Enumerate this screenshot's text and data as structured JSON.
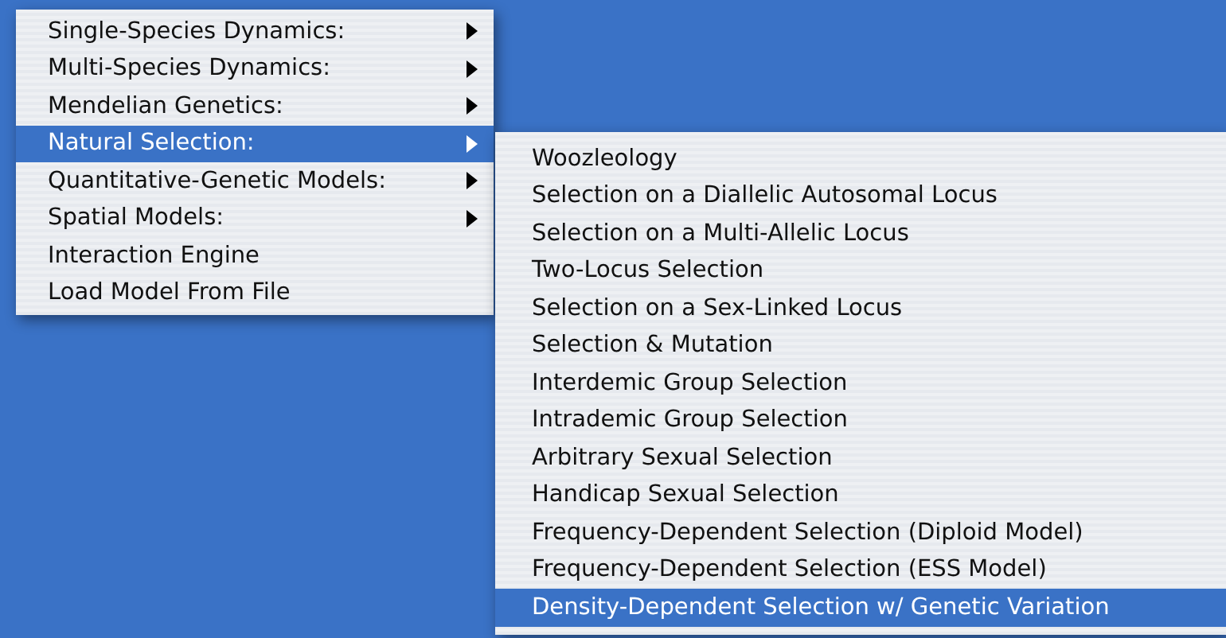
{
  "menu": {
    "items": [
      {
        "label": "Single-Species Dynamics:",
        "kind": "submenu",
        "selected": false
      },
      {
        "label": "Multi-Species Dynamics:",
        "kind": "submenu",
        "selected": false
      },
      {
        "label": "Mendelian Genetics:",
        "kind": "submenu",
        "selected": false
      },
      {
        "label": "Natural Selection:",
        "kind": "submenu",
        "selected": true
      },
      {
        "label": "Quantitative-Genetic Models:",
        "kind": "submenu",
        "selected": false
      },
      {
        "label": "Spatial Models:",
        "kind": "submenu",
        "selected": false
      },
      {
        "label": "Interaction Engine",
        "kind": "command",
        "selected": false
      },
      {
        "label": "Load Model From File",
        "kind": "command",
        "selected": false
      }
    ]
  },
  "submenu": {
    "items": [
      {
        "label": "Woozleology",
        "selected": false
      },
      {
        "label": "Selection on a Diallelic Autosomal Locus",
        "selected": false
      },
      {
        "label": "Selection on a Multi-Allelic Locus",
        "selected": false
      },
      {
        "label": "Two-Locus Selection",
        "selected": false
      },
      {
        "label": "Selection on a Sex-Linked Locus",
        "selected": false
      },
      {
        "label": "Selection & Mutation",
        "selected": false
      },
      {
        "label": "Interdemic Group Selection",
        "selected": false
      },
      {
        "label": "Intrademic Group Selection",
        "selected": false
      },
      {
        "label": "Arbitrary Sexual Selection",
        "selected": false
      },
      {
        "label": "Handicap Sexual Selection",
        "selected": false
      },
      {
        "label": "Frequency-Dependent Selection (Diploid Model)",
        "selected": false
      },
      {
        "label": "Frequency-Dependent Selection (ESS Model)",
        "selected": false
      },
      {
        "label": "Density-Dependent Selection w/ Genetic Variation",
        "selected": true
      }
    ]
  }
}
